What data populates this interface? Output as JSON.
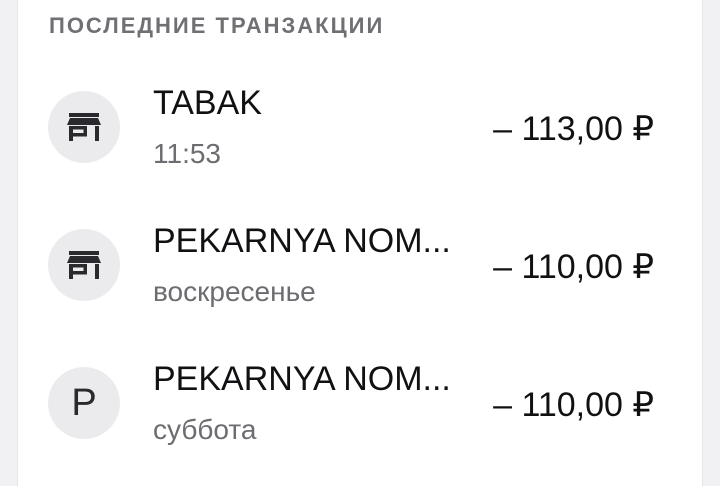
{
  "section": {
    "title": "ПОСЛЕДНИЕ ТРАНЗАКЦИИ"
  },
  "transactions": [
    {
      "merchant": "TABAK",
      "meta": "11:53",
      "amount": "– 113,00 ₽",
      "icon": "store-icon"
    },
    {
      "merchant": "PEKARNYA NOM...",
      "meta": "воскресенье",
      "amount": "– 110,00 ₽",
      "icon": "store-icon"
    },
    {
      "merchant": "PEKARNYA NOM...",
      "meta": "суббота",
      "amount": "– 110,00 ₽",
      "avatar_letter": "P"
    }
  ]
}
